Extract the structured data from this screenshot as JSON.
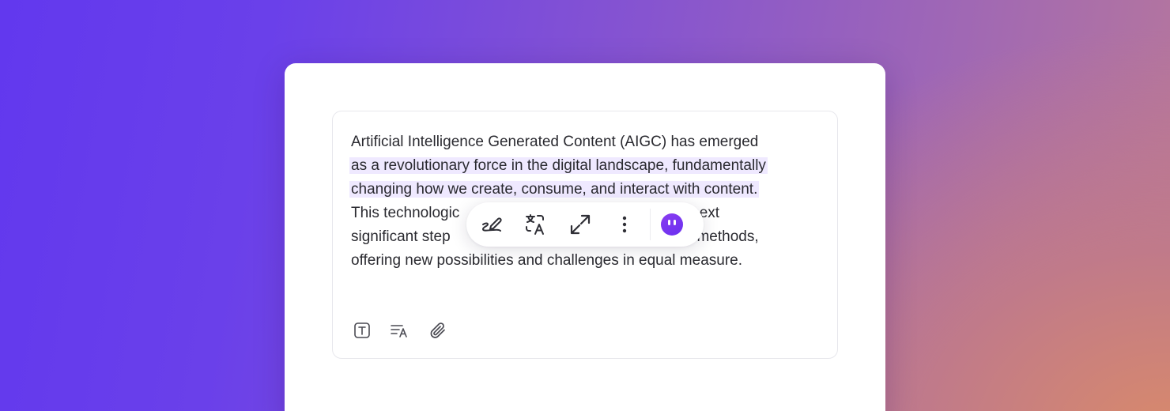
{
  "editor": {
    "lines": [
      "Artificial Intelligence Generated Content (AIGC) has emerged",
      "as a revolutionary force in the digital landscape, fundamentally",
      "changing how we create, consume, and interact with content.",
      "This technologic",
      "e next",
      "significant step ",
      "ation methods,",
      "offering new possibilities and challenges in equal measure."
    ],
    "highlight_color": "#efe9ff"
  },
  "bottom_toolbar": {
    "icons": [
      "text-format-icon",
      "text-align-language-icon",
      "paperclip-icon"
    ]
  },
  "floating_toolbar": {
    "icons": [
      "pen-stroke-icon",
      "translate-icon",
      "expand-icon",
      "more-vertical-icon",
      "ai-assistant-icon"
    ],
    "ai_color": "#7a36f0"
  },
  "theme": {
    "background_start": "#6238ee",
    "background_end": "#b8789a",
    "text_color": "#2a2a30"
  }
}
